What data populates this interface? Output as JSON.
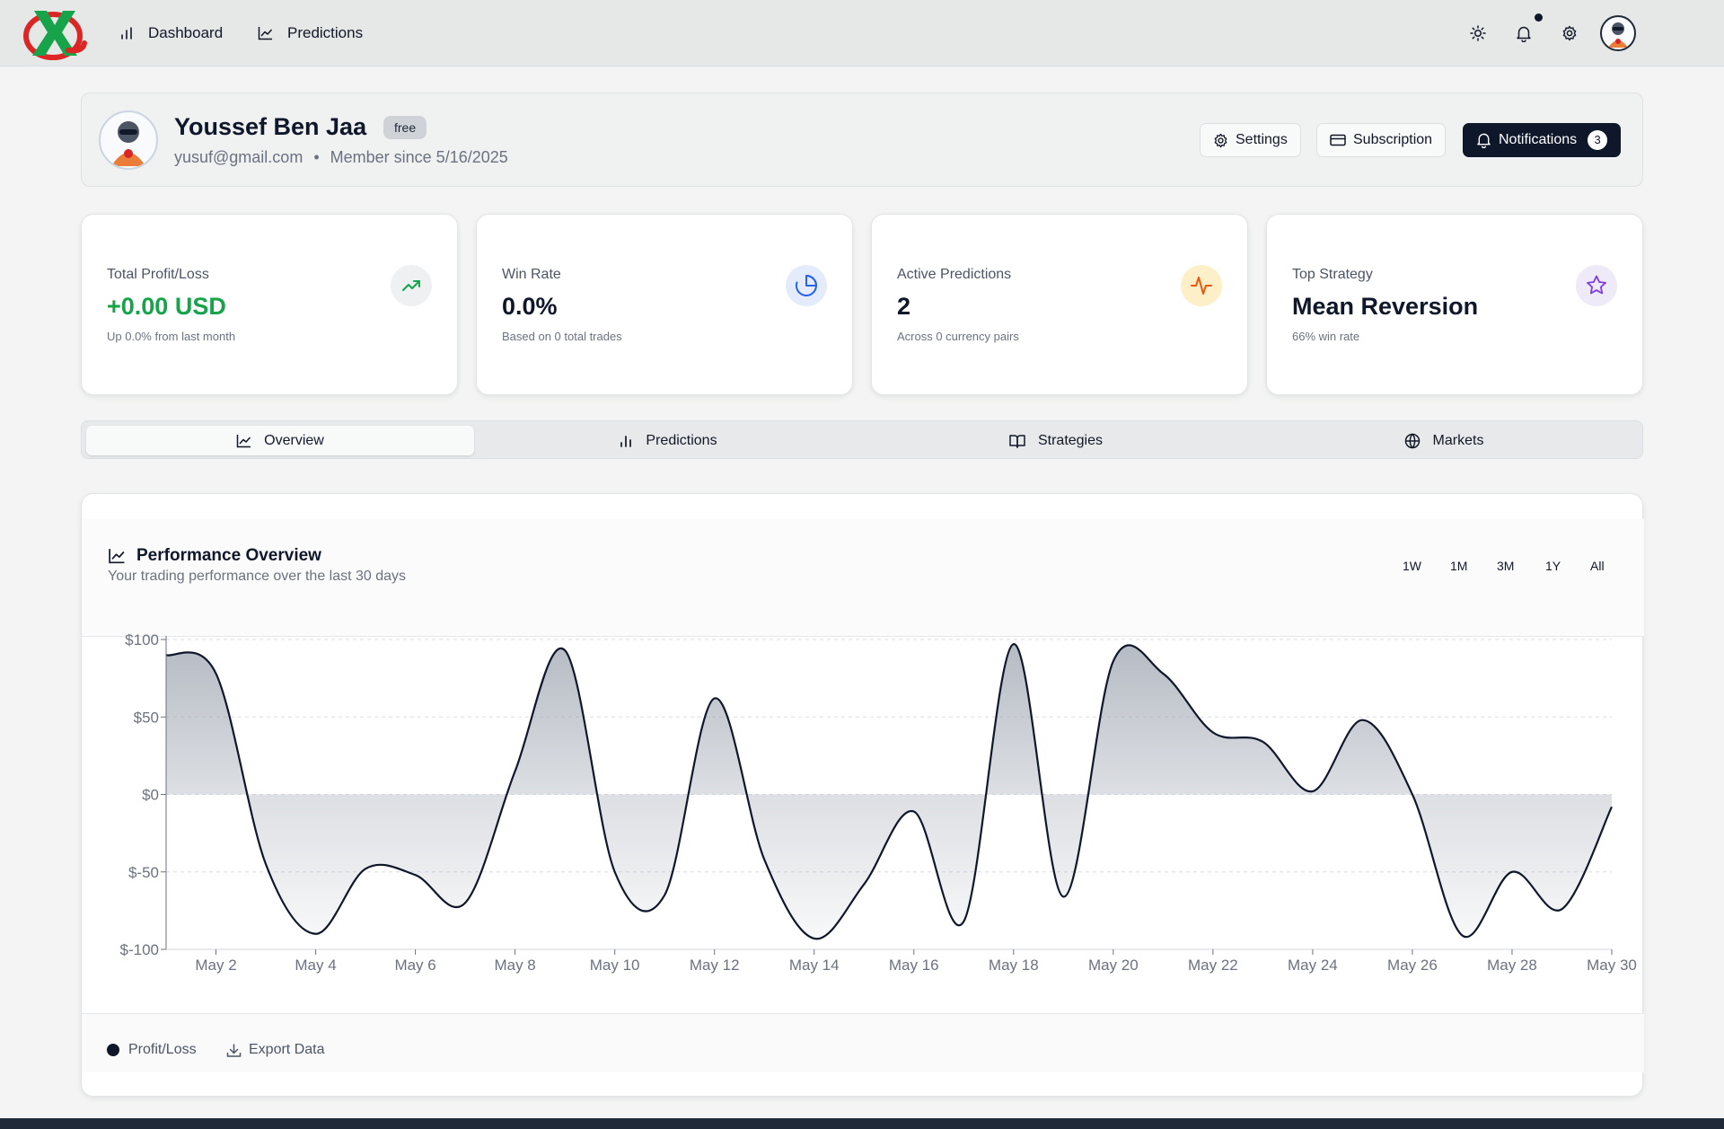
{
  "nav": {
    "links": [
      {
        "label": "Dashboard",
        "icon": "bar-chart-icon"
      },
      {
        "label": "Predictions",
        "icon": "line-chart-icon"
      }
    ],
    "icons": [
      "sun-icon",
      "bell-icon",
      "gear-icon"
    ]
  },
  "profile": {
    "name": "Youssef Ben Jaa",
    "plan": "free",
    "email": "yusuf@gmail.com",
    "separator": "•",
    "member_since": "Member since 5/16/2025",
    "buttons": {
      "settings": "Settings",
      "subscription": "Subscription",
      "notifications": "Notifications"
    },
    "notification_count": "3"
  },
  "stats": [
    {
      "label": "Total Profit/Loss",
      "value": "+0.00 USD",
      "sub": "Up 0.0% from last month",
      "icon": "trending-up-icon",
      "color": "#16a34a"
    },
    {
      "label": "Win Rate",
      "value": "0.0%",
      "sub": "Based on 0 total trades",
      "icon": "pie-chart-icon",
      "color": "#2563eb"
    },
    {
      "label": "Active Predictions",
      "value": "2",
      "sub": "Across 0 currency pairs",
      "icon": "activity-icon",
      "color": "#ea580c"
    },
    {
      "label": "Top Strategy",
      "value": "Mean Reversion",
      "sub": "66% win rate",
      "icon": "star-icon",
      "color": "#7c3aed"
    }
  ],
  "tabs": [
    {
      "label": "Overview",
      "icon": "line-chart-icon",
      "active": true
    },
    {
      "label": "Predictions",
      "icon": "bar-chart-icon",
      "active": false
    },
    {
      "label": "Strategies",
      "icon": "book-open-icon",
      "active": false
    },
    {
      "label": "Markets",
      "icon": "globe-icon",
      "active": false
    }
  ],
  "performance": {
    "title": "Performance Overview",
    "subtitle": "Your trading performance over the last 30 days",
    "ranges": [
      "1W",
      "1M",
      "3M",
      "1Y",
      "All"
    ],
    "legend": "Profit/Loss",
    "export_label": "Export Data"
  },
  "chart_data": {
    "type": "area",
    "x": [
      "May 1",
      "May 2",
      "May 3",
      "May 4",
      "May 5",
      "May 6",
      "May 7",
      "May 8",
      "May 9",
      "May 10",
      "May 11",
      "May 12",
      "May 13",
      "May 14",
      "May 15",
      "May 16",
      "May 17",
      "May 18",
      "May 19",
      "May 20",
      "May 21",
      "May 22",
      "May 23",
      "May 24",
      "May 25",
      "May 26",
      "May 27",
      "May 28",
      "May 29",
      "May 30"
    ],
    "series": [
      {
        "name": "Profit/Loss",
        "values": [
          90,
          78,
          -45,
          -90,
          -48,
          -52,
          -70,
          15,
          93,
          -50,
          -65,
          62,
          -42,
          -93,
          -58,
          -11,
          -82,
          97,
          -66,
          86,
          78,
          40,
          34,
          2,
          48,
          0,
          -91,
          -50,
          -74,
          -8
        ]
      }
    ],
    "xticks": [
      "May 2",
      "May 4",
      "May 6",
      "May 8",
      "May 10",
      "May 12",
      "May 14",
      "May 16",
      "May 18",
      "May 20",
      "May 22",
      "May 24",
      "May 26",
      "May 28",
      "May 30"
    ],
    "yticks": [
      "$100",
      "$50",
      "$0",
      "$-50",
      "$-100"
    ],
    "ylim": [
      -100,
      100
    ],
    "grid": true,
    "line_color": "#0f172a",
    "fill_color": "#9ca3af"
  }
}
